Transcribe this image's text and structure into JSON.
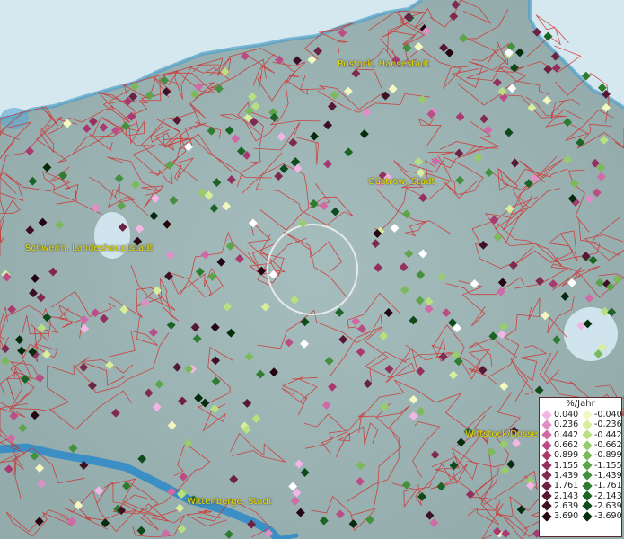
{
  "labels": {
    "rostock": "Rostock, Hansestadt",
    "guestrow": "Güstrow, Stadt",
    "schwerin": "Schwerin, Landeshauptstadt",
    "wittstock": "Wittstock/Dosse",
    "wittenberge": "Wittenberge, Stadt"
  },
  "legend": {
    "title": "%/Jahr",
    "positive": [
      "0.040",
      "0.236",
      "0.442",
      "0.662",
      "0.899",
      "1.155",
      "1.439",
      "1.761",
      "2.143",
      "2.639",
      "3.690"
    ],
    "negative": [
      "-0.040",
      "-0.236",
      "-0.442",
      "-0.662",
      "-0.899",
      "-1.155",
      "-1.439",
      "-1.761",
      "-2.143",
      "-2.639",
      "-3.690"
    ],
    "positive_colors": [
      "#f2b6e6",
      "#e08ec6",
      "#d06aa6",
      "#bb4d86",
      "#a83a70",
      "#94305e",
      "#802a50",
      "#6c2242",
      "#561833",
      "#3e1024",
      "#240612"
    ],
    "negative_colors": [
      "#f4f8c0",
      "#d8ee9a",
      "#b8df80",
      "#98cc6a",
      "#7aba58",
      "#5ea44a",
      "#44903c",
      "#2e7c30",
      "#1c6426",
      "#0e4a1a",
      "#062c0e"
    ]
  },
  "colors": {
    "water": "#d6e8ef",
    "land": "#9db5b5",
    "boundary": "#d0302e",
    "marker_white": "#ffffff"
  }
}
